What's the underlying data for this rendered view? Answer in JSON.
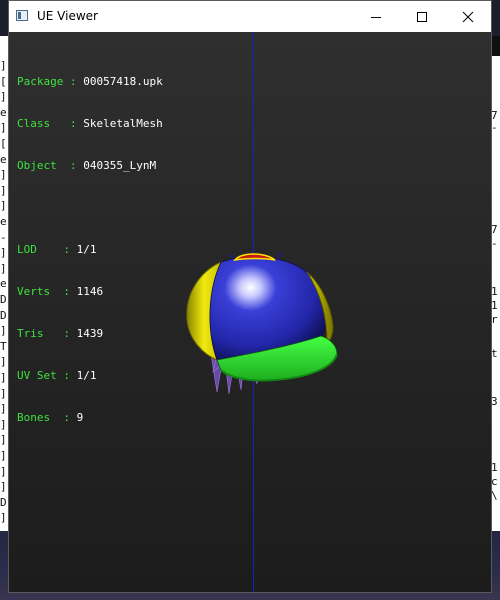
{
  "window": {
    "title": "UE Viewer",
    "controls": {
      "minimize": "minimize-icon",
      "maximize": "maximize-icon",
      "close": "close-icon"
    }
  },
  "info": {
    "package_label": "Package",
    "package_value": "00057418.upk",
    "class_label": "Class",
    "class_value": "SkeletalMesh",
    "object_label": "Object",
    "object_value": "040355_LynM",
    "lod_label": "LOD",
    "lod_value": "1/1",
    "verts_label": "Verts",
    "verts_value": "1146",
    "tris_label": "Tris",
    "tris_value": "1439",
    "uvset_label": "UV Set",
    "uvset_value": "1/1",
    "bones_label": "Bones",
    "bones_value": "9"
  },
  "colors": {
    "label_green": "#3ee23e",
    "value_white": "#ffffff",
    "axis_blue": "#1a20c8",
    "cap_blue": "#2a2fb8",
    "cap_yellow": "#e8e000",
    "cap_brim_green": "#33f033",
    "hair_purple": "#7b5ab8"
  },
  "background_left_chars": [
    "]",
    "[",
    "]",
    "e",
    "]",
    "[",
    "e",
    "]",
    "]",
    "]",
    "e",
    "-",
    "]",
    "]",
    "e",
    "D",
    "D",
    "]",
    "T",
    "]",
    "]",
    "]",
    "]",
    "]",
    "]",
    "]",
    "]",
    "]",
    "D",
    "]",
    "e",
    "]"
  ],
  "background_right_chars": [
    "7",
    "-",
    "7",
    "-",
    "1",
    "1",
    "r",
    "t",
    "3",
    "1",
    "c",
    "\\"
  ]
}
